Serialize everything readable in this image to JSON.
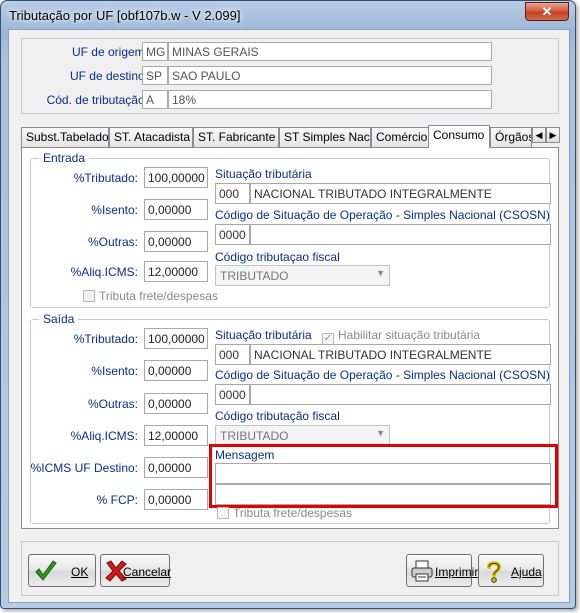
{
  "window": {
    "title": "Tributação por UF [obf107b.w - V 2.099]",
    "close_label": "✕"
  },
  "header": {
    "origem": {
      "label": "UF de origem:",
      "code": "MG",
      "name": "MINAS GERAIS"
    },
    "destino": {
      "label": "UF de destino:",
      "code": "SP",
      "name": "SAO PAULO"
    },
    "tributacao": {
      "label": "Cód. de tributação:",
      "code": "A",
      "value": "18%"
    }
  },
  "tabs": [
    {
      "label": "Subst.Tabelado"
    },
    {
      "label": "ST. Atacadista"
    },
    {
      "label": "ST. Fabricante"
    },
    {
      "label": "ST Simples Nac."
    },
    {
      "label": "Comércio"
    },
    {
      "label": "Consumo",
      "active": true
    },
    {
      "label": "Órgãos"
    }
  ],
  "entrada": {
    "legend": "Entrada",
    "tributado": {
      "label": "%Tributado:",
      "value": "100,00000"
    },
    "isento": {
      "label": "%Isento:",
      "value": "0,00000"
    },
    "outras": {
      "label": "%Outras:",
      "value": "0,00000"
    },
    "aliq": {
      "label": "%Aliq.ICMS:",
      "value": "12,00000"
    },
    "frete": {
      "label": "Tributa frete/despesas"
    },
    "situacao": {
      "label": "Situação tributária",
      "code": "000",
      "desc": "NACIONAL TRIBUTADO INTEGRALMENTE"
    },
    "csosn": {
      "label": "Código de Situação de Operação - Simples Nacional (CSOSN)",
      "code": "0000",
      "desc": ""
    },
    "fiscal": {
      "label": "Código tributaçao fiscal",
      "value": "TRIBUTADO"
    }
  },
  "saida": {
    "legend": "Saída",
    "tributado": {
      "label": "%Tributado:",
      "value": "100,00000"
    },
    "isento": {
      "label": "%Isento:",
      "value": "0,00000"
    },
    "outras": {
      "label": "%Outras:",
      "value": "0,00000"
    },
    "aliq": {
      "label": "%Aliq.ICMS:",
      "value": "12,00000"
    },
    "icms_uf": {
      "label": "%ICMS UF Destino:",
      "value": "0,00000"
    },
    "fcp": {
      "label": "% FCP:",
      "value": "0,00000"
    },
    "situacao": {
      "label": "Situação tributária",
      "code": "000",
      "desc": "NACIONAL TRIBUTADO INTEGRALMENTE"
    },
    "habilitar": {
      "label": "Habilitar situação tributária",
      "mark": "✓"
    },
    "csosn": {
      "label": "Código de Situação de Operação - Simples Nacional (CSOSN)",
      "code": "0000",
      "desc": ""
    },
    "fiscal": {
      "label": "Código tributação fiscal",
      "value": "TRIBUTADO"
    },
    "mensagem": {
      "label": "Mensagem",
      "line1": "",
      "line2": ""
    },
    "frete": {
      "label": "Tributa frete/despesas"
    }
  },
  "buttons": {
    "ok": "OK",
    "cancelar": "Cancelar",
    "imprimir": "Imprimir",
    "ajuda": "Ajuda"
  },
  "colors": {
    "label_blue": "#0a2e8a",
    "highlight_red": "#e00000"
  }
}
